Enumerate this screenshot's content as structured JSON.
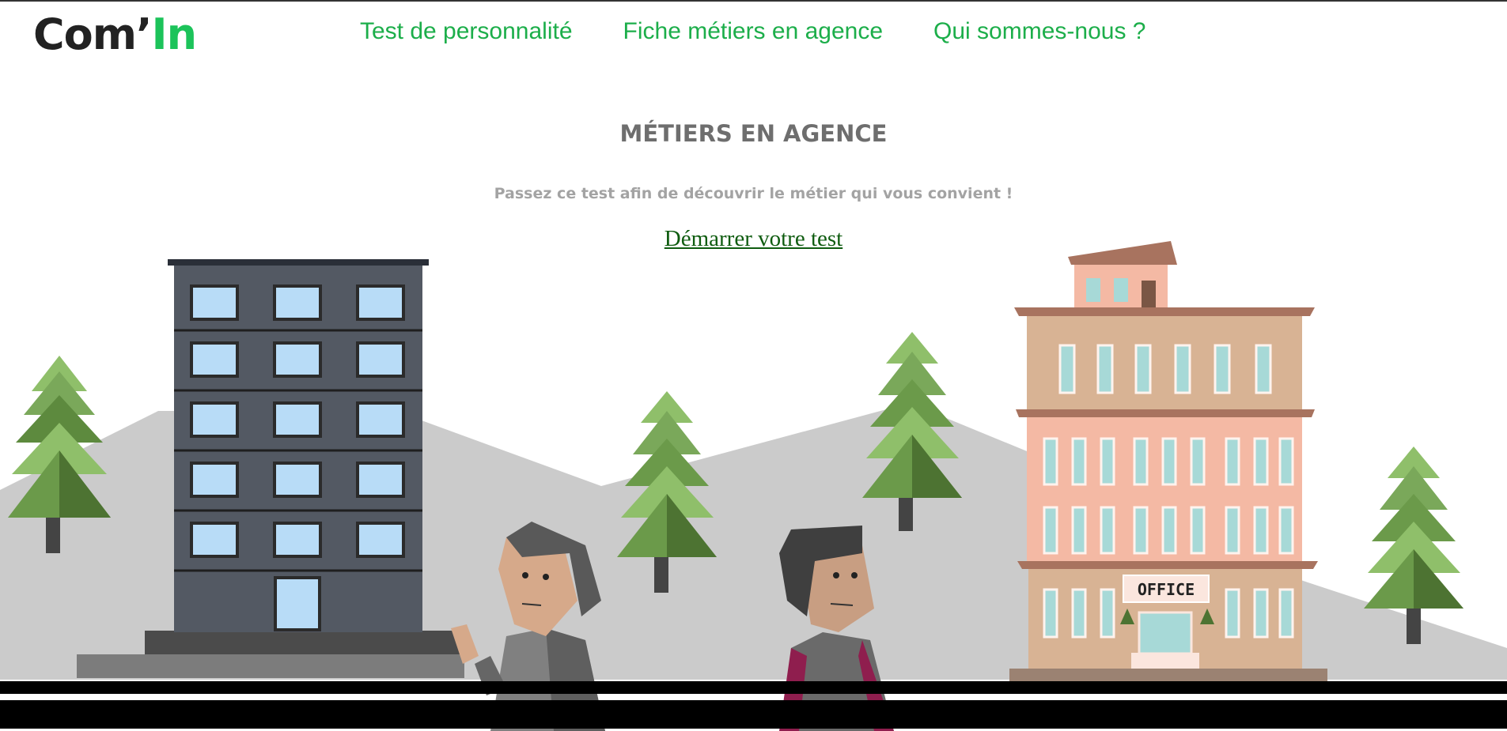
{
  "header": {
    "logo": {
      "part1": "Com’",
      "part2": "In"
    },
    "nav": [
      {
        "label": "Test de personnalité"
      },
      {
        "label": "Fiche métiers en agence"
      },
      {
        "label": "Qui sommes-nous ?"
      }
    ]
  },
  "main": {
    "title": "MÉTIERS EN AGENCE",
    "subtitle": "Passez ce test afin de découvrir le métier qui vous convient !",
    "cta_label": "Démarrer votre test"
  },
  "illustration": {
    "office_sign": "OFFICE"
  },
  "colors": {
    "brand_green": "#1cc35a",
    "nav_green": "#1cae4a",
    "cta_green": "#0f5c10",
    "title_gray": "#6e6e6e",
    "subtitle_gray": "#a3a3a3"
  }
}
